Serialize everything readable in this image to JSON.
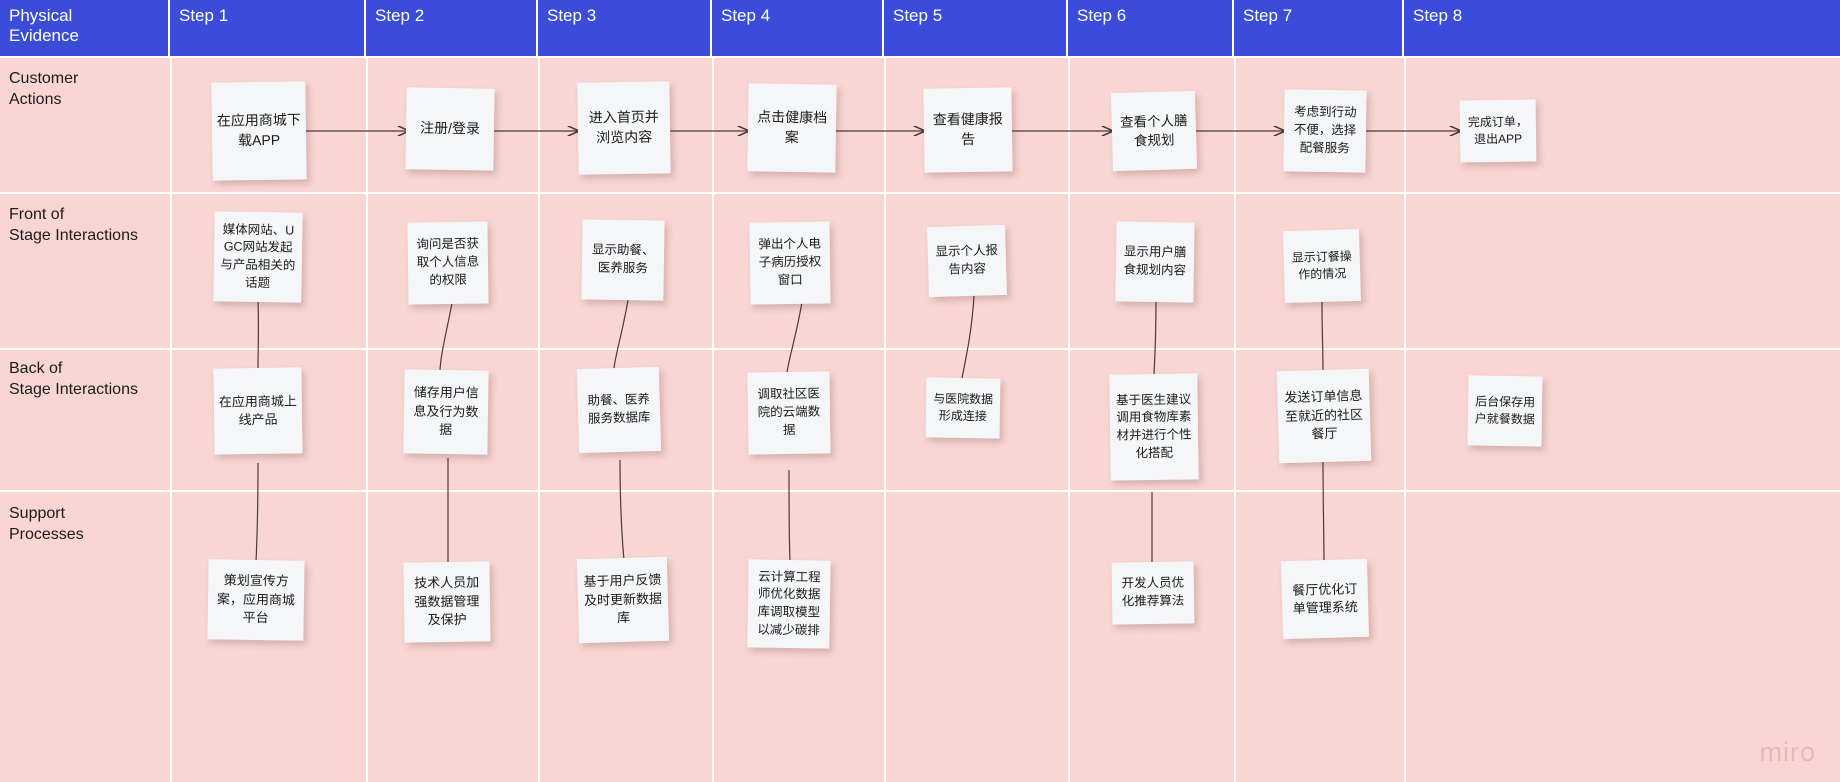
{
  "board": {
    "background_color": "#f9d6d3",
    "header_color": "#3b4cd8",
    "note_color": "#f4f6f8",
    "watermark": "miro"
  },
  "header": {
    "corner_label": "Physical\nEvidence",
    "steps": [
      {
        "label": "Step 1"
      },
      {
        "label": "Step 2"
      },
      {
        "label": "Step 3"
      },
      {
        "label": "Step 4"
      },
      {
        "label": "Step 5"
      },
      {
        "label": "Step 6"
      },
      {
        "label": "Step 7"
      },
      {
        "label": "Step 8"
      }
    ]
  },
  "lanes": [
    {
      "label": "Customer\nActions"
    },
    {
      "label": "Front of\nStage Interactions"
    },
    {
      "label": "Back of\nStage Interactions"
    },
    {
      "label": "Support\nProcesses"
    }
  ],
  "notes": {
    "customer_actions": [
      {
        "step": 1,
        "text": "在应用商城下载APP"
      },
      {
        "step": 2,
        "text": "注册/登录"
      },
      {
        "step": 3,
        "text": "进入首页并浏览内容"
      },
      {
        "step": 4,
        "text": "点击健康档案"
      },
      {
        "step": 5,
        "text": "查看健康报告"
      },
      {
        "step": 6,
        "text": "查看个人膳食规划"
      },
      {
        "step": 7,
        "text": "考虑到行动不便，选择配餐服务"
      },
      {
        "step": 8,
        "text": "完成订单，退出APP"
      }
    ],
    "front_stage": [
      {
        "step": 1,
        "text": "媒体网站、UGC网站发起与产品相关的话题"
      },
      {
        "step": 2,
        "text": "询问是否获取个人信息的权限"
      },
      {
        "step": 3,
        "text": "显示助餐、医养服务"
      },
      {
        "step": 4,
        "text": "弹出个人电子病历授权窗口"
      },
      {
        "step": 5,
        "text": "显示个人报告内容"
      },
      {
        "step": 6,
        "text": "显示用户膳食规划内容"
      },
      {
        "step": 7,
        "text": "显示订餐操作的情况"
      }
    ],
    "back_stage": [
      {
        "step": 1,
        "text": "在应用商城上线产品"
      },
      {
        "step": 2,
        "text": "储存用户信息及行为数据"
      },
      {
        "step": 3,
        "text": "助餐、医养服务数据库"
      },
      {
        "step": 4,
        "text": "调取社区医院的云端数据"
      },
      {
        "step": 5,
        "text": "与医院数据形成连接"
      },
      {
        "step": 6,
        "text": "基于医生建议调用食物库素材并进行个性化搭配"
      },
      {
        "step": 7,
        "text": "发送订单信息至就近的社区餐厅"
      },
      {
        "step": 8,
        "text": "后台保存用户就餐数据"
      }
    ],
    "support_processes": [
      {
        "step": 1,
        "text": "策划宣传方案，应用商城平台"
      },
      {
        "step": 2,
        "text": "技术人员加强数据管理及保护"
      },
      {
        "step": 3,
        "text": "基于用户反馈及时更新数据库"
      },
      {
        "step": 4,
        "text": "云计算工程师优化数据库调取模型以减少碳排"
      },
      {
        "step": 6,
        "text": "开发人员优化推荐算法"
      },
      {
        "step": 7,
        "text": "餐厅优化订单管理系统"
      }
    ]
  },
  "arrows": {
    "customer_flow_count": 7,
    "direction": "left-to-right"
  }
}
